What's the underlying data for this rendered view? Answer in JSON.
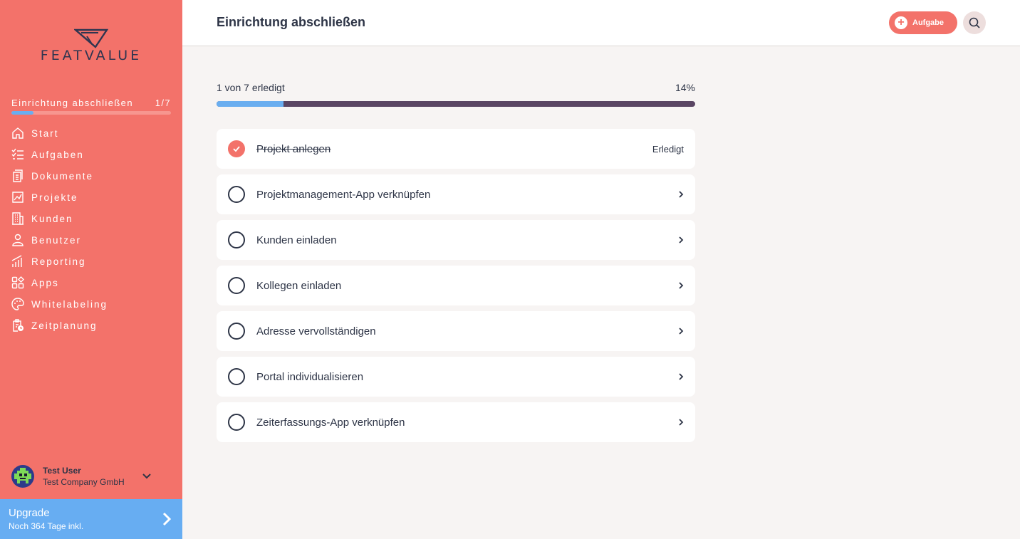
{
  "brand": {
    "name": "FEATVALUE"
  },
  "sidebar": {
    "setup": {
      "label": "Einrichtung abschließen",
      "count": "1/7",
      "progress": 0.14
    },
    "items": [
      {
        "label": "Start",
        "icon": "home-icon"
      },
      {
        "label": "Aufgaben",
        "icon": "checklist-icon"
      },
      {
        "label": "Dokumente",
        "icon": "document-icon"
      },
      {
        "label": "Projekte",
        "icon": "chart-board-icon"
      },
      {
        "label": "Kunden",
        "icon": "building-icon"
      },
      {
        "label": "Benutzer",
        "icon": "user-icon"
      },
      {
        "label": "Reporting",
        "icon": "bar-chart-icon"
      },
      {
        "label": "Apps",
        "icon": "apps-icon"
      },
      {
        "label": "Whitelabeling",
        "icon": "palette-icon"
      },
      {
        "label": "Zeitplanung",
        "icon": "clipboard-clock-icon"
      }
    ],
    "user": {
      "name": "Test User",
      "company": "Test Company GmbH"
    },
    "upgrade": {
      "title": "Upgrade",
      "subtitle": "Noch 364 Tage inkl."
    }
  },
  "header": {
    "title": "Einrichtung abschließen",
    "task_button": "Aufgabe"
  },
  "progress": {
    "text": "1 von 7 erledigt",
    "percent_label": "14%",
    "value": 0.14
  },
  "tasks": [
    {
      "label": "Projekt anlegen",
      "done": true,
      "status": "Erledigt"
    },
    {
      "label": "Projektmanagement-App verknüpfen",
      "done": false
    },
    {
      "label": "Kunden einladen",
      "done": false
    },
    {
      "label": "Kollegen einladen",
      "done": false
    },
    {
      "label": "Adresse vervollständigen",
      "done": false
    },
    {
      "label": "Portal individualisieren",
      "done": false
    },
    {
      "label": "Zeiterfassungs-App verknüpfen",
      "done": false
    }
  ],
  "colors": {
    "accent": "#f3726a",
    "progress": "#6aaef0",
    "track": "#5a4563",
    "upgrade": "#67adf2"
  }
}
